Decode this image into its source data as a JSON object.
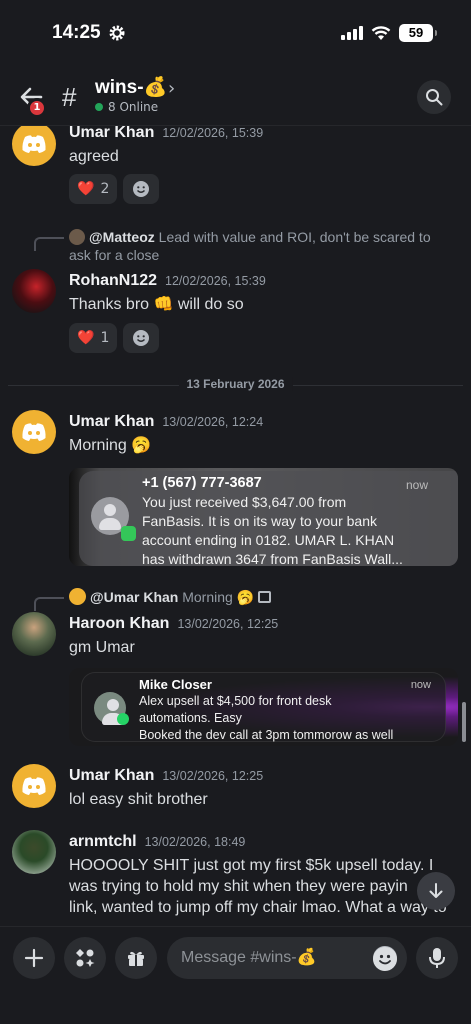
{
  "status": {
    "time": "14:25",
    "battery": "59"
  },
  "header": {
    "badge": "1",
    "channel": "wins-💰",
    "online": "8 Online"
  },
  "messages": {
    "m1": {
      "author": "Umar Khan",
      "ts": "12/02/2026, 15:39",
      "text": "agreed",
      "reaction_emoji": "❤️",
      "reaction_count": "2"
    },
    "m2": {
      "reply_author": "@Matteoz",
      "reply_text": "Lead with value and ROI, don't be scared to",
      "reply_text2": "ask for a close",
      "author": "RohanN122",
      "ts": "12/02/2026, 15:39",
      "text": "Thanks bro 👊 will do so",
      "reaction_emoji": "❤️",
      "reaction_count": "1"
    },
    "divider": "13 February 2026",
    "m3": {
      "author": "Umar Khan",
      "ts": "13/02/2026, 12:24",
      "text": "Morning 🥱",
      "notif_title": "+1 (567) 777-3687",
      "notif_time": "now",
      "notif_l1": "You just received $3,647.00 from",
      "notif_l2": "FanBasis. It is on its way to your bank",
      "notif_l3": "account ending in 0182. UMAR L. KHAN",
      "notif_l4": "has withdrawn 3647 from FanBasis Wall..."
    },
    "m4": {
      "reply_author": "@Umar Khan",
      "reply_text": "Morning 🥱",
      "author": "Haroon Khan",
      "ts": "13/02/2026, 12:25",
      "text": "gm Umar",
      "notif_title": "Mike Closer",
      "notif_time": "now",
      "notif_l1": "Alex upsell at $4,500 for front desk",
      "notif_l2": "automations. Easy",
      "notif_l3": "Booked the dev call at 3pm tommorow as well"
    },
    "m5": {
      "author": "Umar Khan",
      "ts": "13/02/2026, 12:25",
      "text": "lol easy shit brother"
    },
    "m6": {
      "author": "arnmtchl",
      "ts": "13/02/2026, 18:49",
      "l1": "HOOOOLY SHIT just got my first $5k upsell today. I",
      "l2": "was trying to hold my shit when they were payin",
      "l3": "link, wanted to jump off my chair lmao. What a way to"
    }
  },
  "composer": {
    "placeholder": "Message #wins-💰"
  }
}
